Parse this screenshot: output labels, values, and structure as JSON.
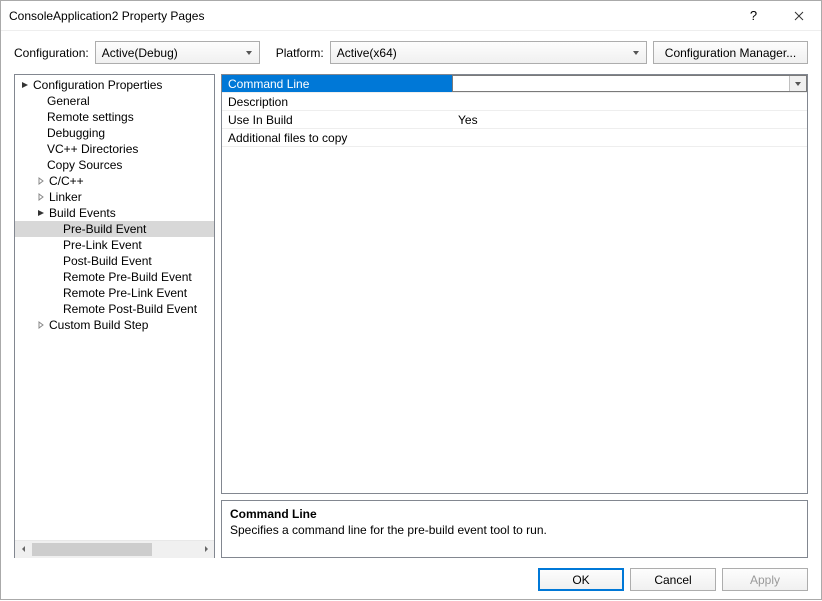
{
  "window": {
    "title": "ConsoleApplication2 Property Pages"
  },
  "toolbar": {
    "configuration_label": "Configuration:",
    "configuration_value": "Active(Debug)",
    "platform_label": "Platform:",
    "platform_value": "Active(x64)",
    "config_manager": "Configuration Manager..."
  },
  "tree": {
    "root": "Configuration Properties",
    "items": [
      {
        "label": "General"
      },
      {
        "label": "Remote settings"
      },
      {
        "label": "Debugging"
      },
      {
        "label": "VC++ Directories"
      },
      {
        "label": "Copy Sources"
      },
      {
        "label": "C/C++",
        "expandable": true
      },
      {
        "label": "Linker",
        "expandable": true
      },
      {
        "label": "Build Events",
        "expanded": true,
        "children": [
          {
            "label": "Pre-Build Event",
            "selected": true
          },
          {
            "label": "Pre-Link Event"
          },
          {
            "label": "Post-Build Event"
          },
          {
            "label": "Remote Pre-Build Event"
          },
          {
            "label": "Remote Pre-Link Event"
          },
          {
            "label": "Remote Post-Build Event"
          }
        ]
      },
      {
        "label": "Custom Build Step",
        "expandable": true
      }
    ]
  },
  "grid": {
    "rows": [
      {
        "name": "Command Line",
        "value": "",
        "selected": true
      },
      {
        "name": "Description",
        "value": ""
      },
      {
        "name": "Use In Build",
        "value": "Yes"
      },
      {
        "name": "Additional files to copy",
        "value": ""
      }
    ]
  },
  "description": {
    "title": "Command Line",
    "text": "Specifies a command line for the pre-build event tool to run."
  },
  "footer": {
    "ok": "OK",
    "cancel": "Cancel",
    "apply": "Apply"
  }
}
